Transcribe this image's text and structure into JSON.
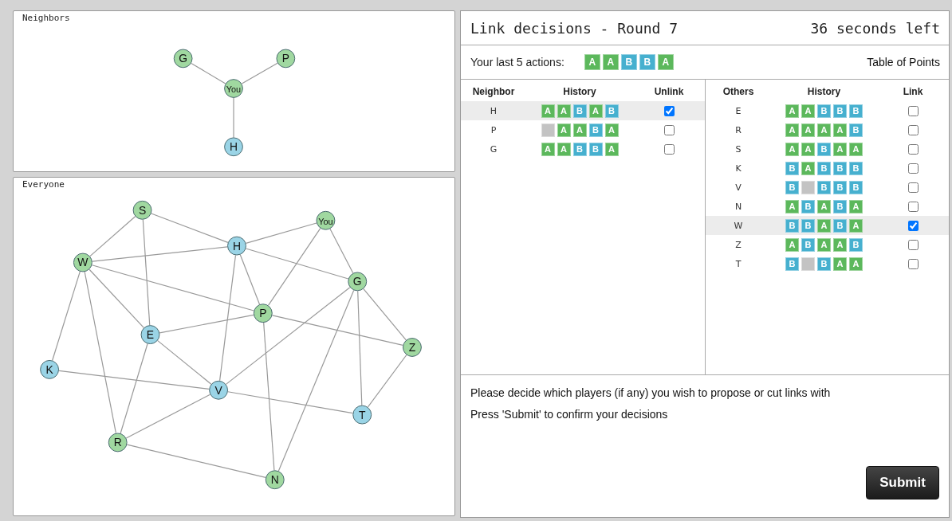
{
  "neighbors_graph": {
    "title": "Neighbors",
    "nodes": [
      {
        "label": "G",
        "color": "#a0d8a0"
      },
      {
        "label": "P",
        "color": "#a0d8a0"
      },
      {
        "label": "You",
        "color": "#a0d8a0"
      },
      {
        "label": "H",
        "color": "#9ad4e6"
      }
    ]
  },
  "everyone_graph": {
    "title": "Everyone",
    "nodes": [
      {
        "label": "S",
        "color": "#a0d8a0"
      },
      {
        "label": "You",
        "color": "#a0d8a0"
      },
      {
        "label": "H",
        "color": "#9ad4e6"
      },
      {
        "label": "W",
        "color": "#a0d8a0"
      },
      {
        "label": "G",
        "color": "#a0d8a0"
      },
      {
        "label": "P",
        "color": "#a0d8a0"
      },
      {
        "label": "E",
        "color": "#9ad4e6"
      },
      {
        "label": "Z",
        "color": "#a0d8a0"
      },
      {
        "label": "K",
        "color": "#9ad4e6"
      },
      {
        "label": "V",
        "color": "#9ad4e6"
      },
      {
        "label": "T",
        "color": "#9ad4e6"
      },
      {
        "label": "R",
        "color": "#a0d8a0"
      },
      {
        "label": "N",
        "color": "#a0d8a0"
      }
    ]
  },
  "header": {
    "title": "Link decisions - Round 7",
    "timer": "36 seconds left"
  },
  "last_actions": {
    "label": "Your last 5 actions:",
    "actions": [
      {
        "kind": "a",
        "label": "A"
      },
      {
        "kind": "a",
        "label": "A"
      },
      {
        "kind": "b",
        "label": "B"
      },
      {
        "kind": "b",
        "label": "B"
      },
      {
        "kind": "a",
        "label": "A"
      }
    ],
    "link": "Table of Points"
  },
  "neighbors_table": {
    "columns": [
      "Neighbor",
      "History",
      "Unlink"
    ],
    "rows": [
      {
        "name": "H",
        "checked": true,
        "history": [
          {
            "kind": "a",
            "label": "A"
          },
          {
            "kind": "a",
            "label": "A"
          },
          {
            "kind": "b",
            "label": "B"
          },
          {
            "kind": "a",
            "label": "A"
          },
          {
            "kind": "b",
            "label": "B"
          }
        ]
      },
      {
        "name": "P",
        "checked": false,
        "history": [
          {
            "kind": "blank"
          },
          {
            "kind": "a",
            "label": "A"
          },
          {
            "kind": "a",
            "label": "A"
          },
          {
            "kind": "b",
            "label": "B"
          },
          {
            "kind": "a",
            "label": "A"
          }
        ]
      },
      {
        "name": "G",
        "checked": false,
        "history": [
          {
            "kind": "a",
            "label": "A"
          },
          {
            "kind": "a",
            "label": "A"
          },
          {
            "kind": "b",
            "label": "B"
          },
          {
            "kind": "b",
            "label": "B"
          },
          {
            "kind": "a",
            "label": "A"
          }
        ]
      }
    ]
  },
  "others_table": {
    "columns": [
      "Others",
      "History",
      "Link"
    ],
    "rows": [
      {
        "name": "E",
        "checked": false,
        "history": [
          {
            "kind": "a",
            "label": "A"
          },
          {
            "kind": "a",
            "label": "A"
          },
          {
            "kind": "b",
            "label": "B"
          },
          {
            "kind": "b",
            "label": "B"
          },
          {
            "kind": "b",
            "label": "B"
          }
        ]
      },
      {
        "name": "R",
        "checked": false,
        "history": [
          {
            "kind": "a",
            "label": "A"
          },
          {
            "kind": "a",
            "label": "A"
          },
          {
            "kind": "a",
            "label": "A"
          },
          {
            "kind": "a",
            "label": "A"
          },
          {
            "kind": "b",
            "label": "B"
          }
        ]
      },
      {
        "name": "S",
        "checked": false,
        "history": [
          {
            "kind": "a",
            "label": "A"
          },
          {
            "kind": "a",
            "label": "A"
          },
          {
            "kind": "b",
            "label": "B"
          },
          {
            "kind": "a",
            "label": "A"
          },
          {
            "kind": "a",
            "label": "A"
          }
        ]
      },
      {
        "name": "K",
        "checked": false,
        "history": [
          {
            "kind": "b",
            "label": "B"
          },
          {
            "kind": "a",
            "label": "A"
          },
          {
            "kind": "b",
            "label": "B"
          },
          {
            "kind": "b",
            "label": "B"
          },
          {
            "kind": "b",
            "label": "B"
          }
        ]
      },
      {
        "name": "V",
        "checked": false,
        "history": [
          {
            "kind": "b",
            "label": "B"
          },
          {
            "kind": "blank"
          },
          {
            "kind": "b",
            "label": "B"
          },
          {
            "kind": "b",
            "label": "B"
          },
          {
            "kind": "b",
            "label": "B"
          }
        ]
      },
      {
        "name": "N",
        "checked": false,
        "history": [
          {
            "kind": "a",
            "label": "A"
          },
          {
            "kind": "b",
            "label": "B"
          },
          {
            "kind": "a",
            "label": "A"
          },
          {
            "kind": "b",
            "label": "B"
          },
          {
            "kind": "a",
            "label": "A"
          }
        ]
      },
      {
        "name": "W",
        "checked": true,
        "history": [
          {
            "kind": "b",
            "label": "B"
          },
          {
            "kind": "b",
            "label": "B"
          },
          {
            "kind": "a",
            "label": "A"
          },
          {
            "kind": "b",
            "label": "B"
          },
          {
            "kind": "a",
            "label": "A"
          }
        ]
      },
      {
        "name": "Z",
        "checked": false,
        "history": [
          {
            "kind": "a",
            "label": "A"
          },
          {
            "kind": "b",
            "label": "B"
          },
          {
            "kind": "a",
            "label": "A"
          },
          {
            "kind": "a",
            "label": "A"
          },
          {
            "kind": "b",
            "label": "B"
          }
        ]
      },
      {
        "name": "T",
        "checked": false,
        "history": [
          {
            "kind": "b",
            "label": "B"
          },
          {
            "kind": "blank"
          },
          {
            "kind": "b",
            "label": "B"
          },
          {
            "kind": "a",
            "label": "A"
          },
          {
            "kind": "a",
            "label": "A"
          }
        ]
      }
    ]
  },
  "instructions": [
    "Please decide which players (if any) you wish to propose or cut links with",
    "Press 'Submit' to confirm your decisions"
  ],
  "submit_button": "Submit"
}
